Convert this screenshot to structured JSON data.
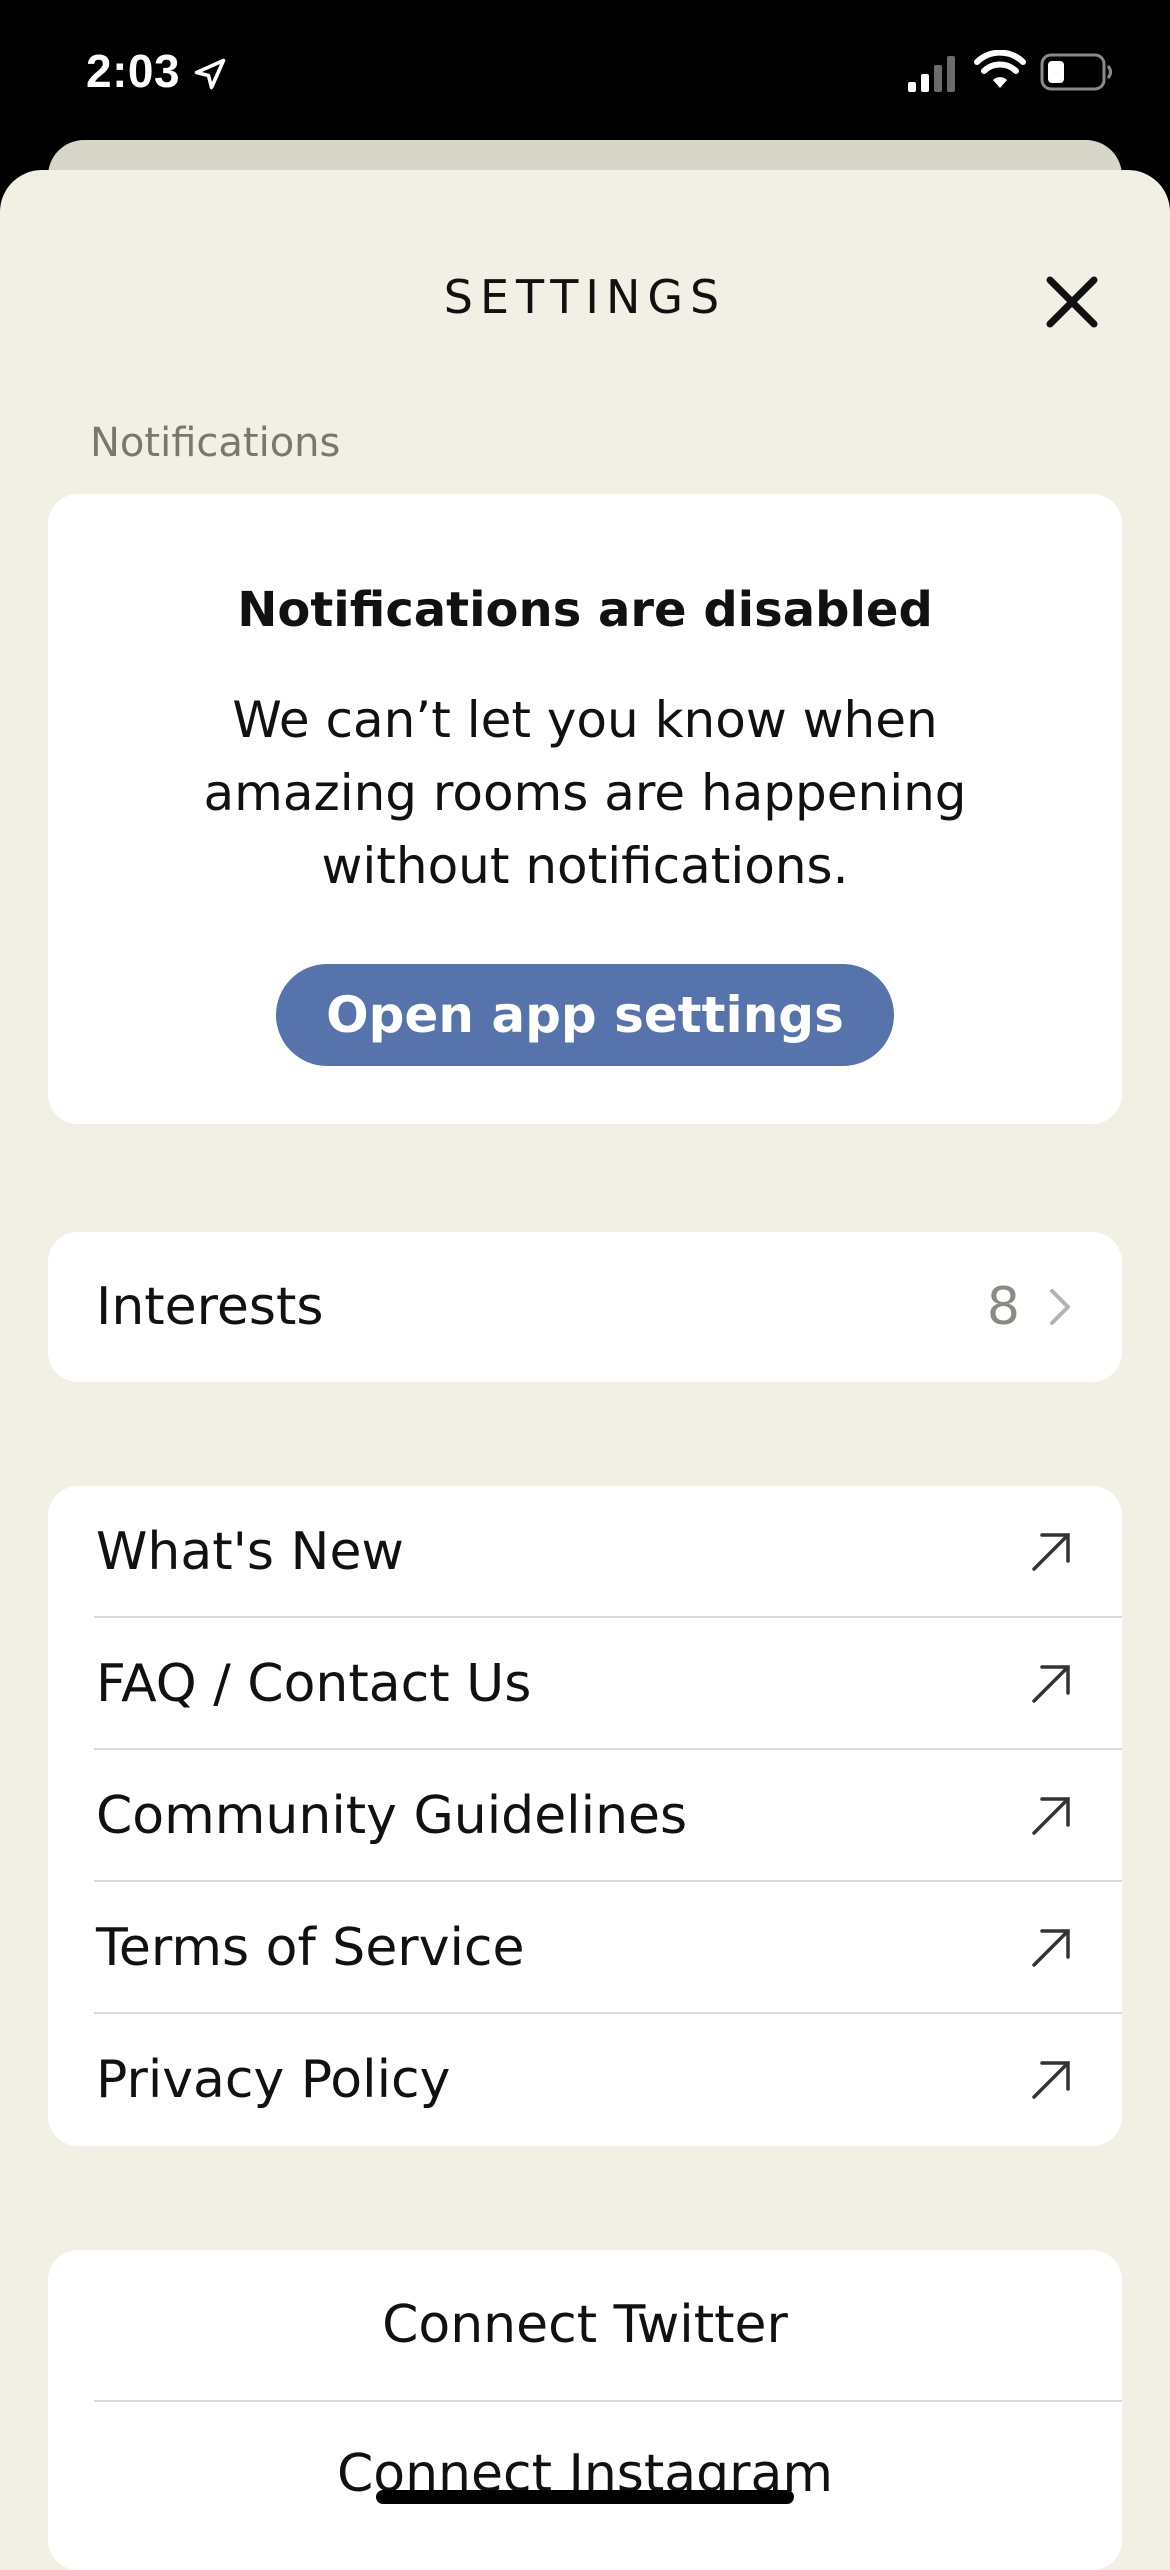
{
  "status_bar": {
    "time": "2:03"
  },
  "header": {
    "title": "SETTINGS"
  },
  "notifications": {
    "section_label": "Notifications",
    "title": "Notifications are disabled",
    "body": "We can’t let you know when amazing rooms are happening without notifications.",
    "button_label": "Open app settings"
  },
  "interests": {
    "label": "Interests",
    "count": "8"
  },
  "links": [
    {
      "label": "What's New"
    },
    {
      "label": "FAQ / Contact Us"
    },
    {
      "label": "Community Guidelines"
    },
    {
      "label": "Terms of Service"
    },
    {
      "label": "Privacy Policy"
    }
  ],
  "social": [
    {
      "label": "Connect Twitter"
    },
    {
      "label": "Connect Instagram"
    }
  ],
  "colors": {
    "background": "#f2efe4",
    "card": "#ffffff",
    "accent": "#5674ab"
  },
  "icons": [
    "location-arrow-icon",
    "signal-icon",
    "wifi-icon",
    "battery-icon",
    "close-icon",
    "chevron-right-icon",
    "external-link-arrow-icon"
  ]
}
